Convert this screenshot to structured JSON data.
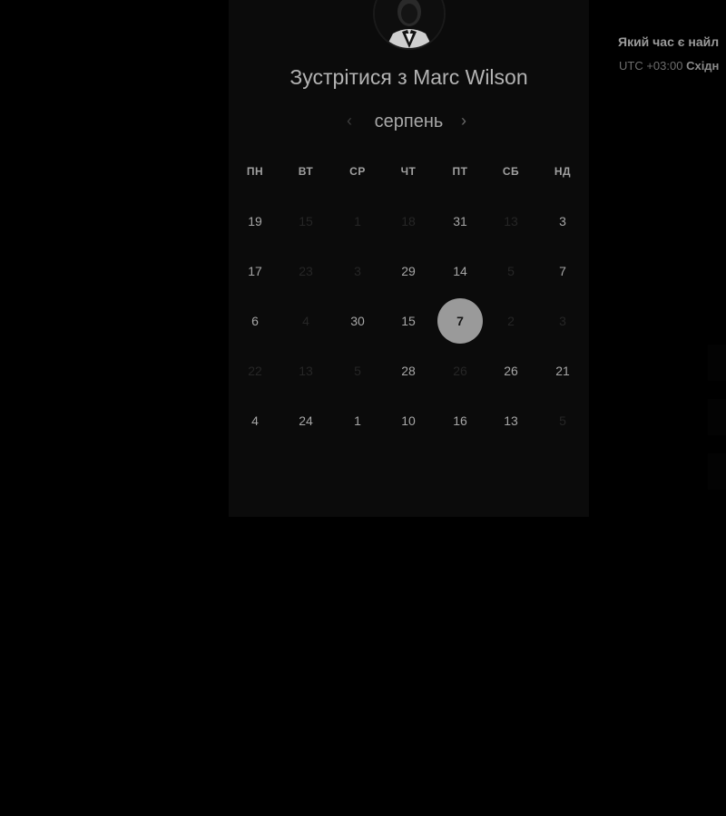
{
  "booking": {
    "title": "Зустрітися з Marc Wilson",
    "month": "серпень",
    "prev_icon": "‹",
    "next_icon": "›",
    "weekdays": [
      "ПН",
      "ВТ",
      "СР",
      "ЧТ",
      "ПТ",
      "СБ",
      "НД"
    ],
    "weeks": [
      [
        {
          "label": "19",
          "available": true
        },
        {
          "label": "15",
          "available": false
        },
        {
          "label": "1",
          "available": false
        },
        {
          "label": "18",
          "available": false
        },
        {
          "label": "31",
          "available": true
        },
        {
          "label": "13",
          "available": false
        },
        {
          "label": "3",
          "available": true
        }
      ],
      [
        {
          "label": "17",
          "available": true
        },
        {
          "label": "23",
          "available": false
        },
        {
          "label": "3",
          "available": false
        },
        {
          "label": "29",
          "available": true
        },
        {
          "label": "14",
          "available": true
        },
        {
          "label": "5",
          "available": false
        },
        {
          "label": "7",
          "available": true
        }
      ],
      [
        {
          "label": "6",
          "available": true
        },
        {
          "label": "4",
          "available": false
        },
        {
          "label": "30",
          "available": true
        },
        {
          "label": "15",
          "available": true
        },
        {
          "label": "7",
          "available": true,
          "selected": true
        },
        {
          "label": "2",
          "available": false
        },
        {
          "label": "3",
          "available": false
        }
      ],
      [
        {
          "label": "22",
          "available": false
        },
        {
          "label": "13",
          "available": false
        },
        {
          "label": "5",
          "available": false
        },
        {
          "label": "28",
          "available": true
        },
        {
          "label": "26",
          "available": false
        },
        {
          "label": "26",
          "available": true
        },
        {
          "label": "21",
          "available": true
        }
      ],
      [
        {
          "label": "4",
          "available": true
        },
        {
          "label": "24",
          "available": true
        },
        {
          "label": "1",
          "available": true
        },
        {
          "label": "10",
          "available": true
        },
        {
          "label": "16",
          "available": true
        },
        {
          "label": "13",
          "available": true
        },
        {
          "label": "5",
          "available": false
        }
      ]
    ]
  },
  "side": {
    "question": "Який час є найл",
    "tz_prefix": "UTC +03:00",
    "tz_name": "Східн"
  },
  "colors": {
    "background": "#000000",
    "card": "#0b0b0b",
    "selected_day": "#9a9a9a"
  }
}
